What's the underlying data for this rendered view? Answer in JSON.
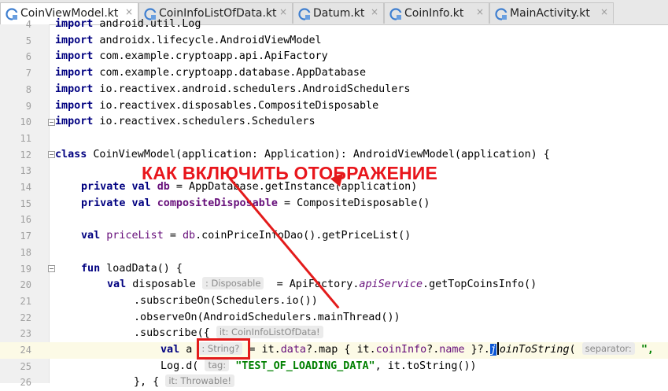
{
  "tabs": [
    {
      "label": "CoinViewModel.kt",
      "active": true
    },
    {
      "label": "CoinInfoListOfData.kt",
      "active": false
    },
    {
      "label": "Datum.kt",
      "active": false
    },
    {
      "label": "CoinInfo.kt",
      "active": false
    },
    {
      "label": "MainActivity.kt",
      "active": false
    }
  ],
  "tab_close_glyph": "×",
  "line_numbers": [
    "4",
    "5",
    "6",
    "7",
    "8",
    "9",
    "10",
    "11",
    "12",
    "13",
    "14",
    "15",
    "16",
    "17",
    "18",
    "19",
    "20",
    "21",
    "22",
    "23",
    "24",
    "25",
    "26"
  ],
  "code": {
    "l4_kw": "import",
    "l4_rest": " android.util.Log",
    "l5_kw": "import",
    "l5_rest": " androidx.lifecycle.AndroidViewModel",
    "l6_kw": "import",
    "l6_rest": " com.example.cryptoapp.api.ApiFactory",
    "l7_kw": "import",
    "l7_rest": " com.example.cryptoapp.database.AppDatabase",
    "l8_kw": "import",
    "l8_rest": " io.reactivex.android.schedulers.AndroidSchedulers",
    "l9_kw": "import",
    "l9_rest": " io.reactivex.disposables.CompositeDisposable",
    "l10_kw": "import",
    "l10_rest": " io.reactivex.schedulers.Schedulers",
    "l12_kw": "class",
    "l12_rest": " CoinViewModel(application: Application): AndroidViewModel(application) {",
    "l14_kw": "private val",
    "l14_field": " db",
    "l14_rest": " = AppDatabase.getInstance(application)",
    "l15_kw": "private val",
    "l15_field": " compositeDisposable",
    "l15_rest": " = CompositeDisposable()",
    "l17_kw": "val",
    "l17_field": " priceList",
    "l17_a": " = ",
    "l17_db": "db",
    "l17_rest": ".coinPriceInfoDao().getPriceList()",
    "l19_kw": "fun",
    "l19_rest": " loadData() {",
    "l20_kw": "val",
    "l20_name": " disposable ",
    "l20_hint": ": Disposable",
    "l20_a": "  = ApiFactory.",
    "l20_field": "apiService",
    "l20_rest": ".getTopCoinsInfo()",
    "l21_rest": ".subscribeOn(Schedulers.io())",
    "l22_rest": ".observeOn(AndroidSchedulers.mainThread())",
    "l23_rest": ".subscribe({ ",
    "l23_hint": "it: CoinInfoListOfData!",
    "l24_kw": "val",
    "l24_name": " a ",
    "l24_hint": ": String?",
    "l24_a": " = it.",
    "l24_data": "data",
    "l24_b": "?.map { it.",
    "l24_coin": "coinInfo",
    "l24_c": "?.",
    "l24_name2": "name",
    "l24_d": " }?.",
    "l24_sel": "j",
    "l24_ital": "oinToString",
    "l24_e": "( ",
    "l24_hint2": "separator:",
    "l24_f": " \",",
    "l25_a": "Log.d( ",
    "l25_hint": "tag:",
    "l25_str": " \"TEST_OF_LOADING_DATA\"",
    "l25_rest": ", it.toString())",
    "l26_a": "}, { ",
    "l26_hint": "it: Throwable!"
  },
  "overlay_text": "КАК ВКЛЮЧИТЬ ОТОБРАЖЕНИЕ",
  "accent_color": "#e31b1b",
  "tab_icon": "kotlin-file-icon"
}
